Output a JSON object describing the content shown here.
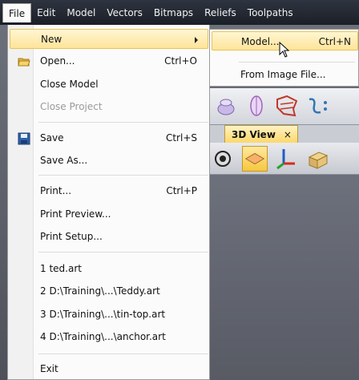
{
  "menubar": {
    "items": [
      "File",
      "Edit",
      "Model",
      "Vectors",
      "Bitmaps",
      "Reliefs",
      "Toolpaths"
    ]
  },
  "file_menu": {
    "new_label": "New",
    "open_label": "Open...",
    "open_shortcut": "Ctrl+O",
    "close_model_label": "Close Model",
    "close_project_label": "Close Project",
    "save_label": "Save",
    "save_shortcut": "Ctrl+S",
    "save_as_label": "Save As...",
    "print_label": "Print...",
    "print_shortcut": "Ctrl+P",
    "print_preview_label": "Print Preview...",
    "print_setup_label": "Print Setup...",
    "recent_files": [
      "1 ted.art",
      "2 D:\\Training\\...\\Teddy.art",
      "3 D:\\Training\\...\\tin-top.art",
      "4 D:\\Training\\...\\anchor.art"
    ],
    "exit_label": "Exit"
  },
  "new_submenu": {
    "model_label": "Model...",
    "model_shortcut": "Ctrl+N",
    "from_image_label": "From Image File..."
  },
  "view_tab": {
    "label": "3D View",
    "close_glyph": "×"
  },
  "colors": {
    "menu_highlight": "#fde49a",
    "menubar_bg": "#1b1f27",
    "tab_active": "#fcd86a"
  },
  "icons": {
    "open": "folder-open-icon",
    "save": "floppy-disk-icon"
  }
}
